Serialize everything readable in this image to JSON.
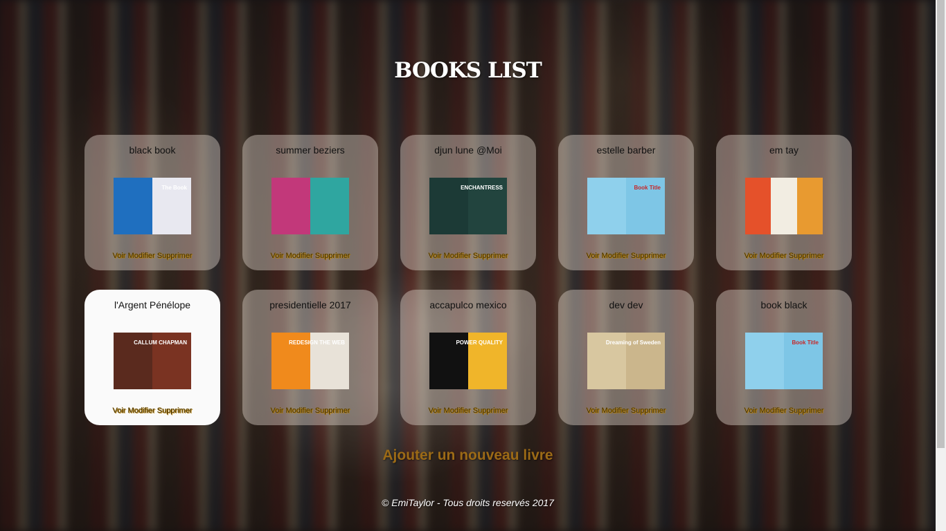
{
  "page": {
    "title": "BOOKS LIST"
  },
  "books": [
    {
      "title": "black book",
      "cover": {
        "colors": [
          "#1f6fbf",
          "#e8e8f0"
        ],
        "label": "The Book"
      }
    },
    {
      "title": "summer beziers",
      "cover": {
        "colors": [
          "#c2387a",
          "#2fa6a0"
        ],
        "label": ""
      }
    },
    {
      "title": "djun lune @Moi",
      "cover": {
        "colors": [
          "#1c3a36",
          "#22443e"
        ],
        "label": "ENCHANTRESS"
      }
    },
    {
      "title": "estelle barber",
      "cover": {
        "colors": [
          "#8fd0ec",
          "#7ec6e6"
        ],
        "label": "Book Title"
      }
    },
    {
      "title": "em tay",
      "cover": {
        "colors": [
          "#e5512a",
          "#f2ede2",
          "#e89a30"
        ],
        "label": ""
      }
    },
    {
      "title": "l'Argent Pénélope",
      "cover": {
        "colors": [
          "#5a2a1e",
          "#7a3322"
        ],
        "label": "CALLUM CHAPMAN"
      }
    },
    {
      "title": "presidentielle 2017",
      "cover": {
        "colors": [
          "#f08a1c",
          "#e8e2d8"
        ],
        "label": "REDESIGN THE WEB"
      }
    },
    {
      "title": "accapulco mexico",
      "cover": {
        "colors": [
          "#111111",
          "#f0b52a"
        ],
        "label": "POWER QUALITY"
      }
    },
    {
      "title": "dev dev",
      "cover": {
        "colors": [
          "#d8c7a0",
          "#cbb68c"
        ],
        "label": "Dreaming of Sweden"
      }
    },
    {
      "title": "book black",
      "cover": {
        "colors": [
          "#8fd0ec",
          "#7ec6e6"
        ],
        "label": "Book Title"
      }
    }
  ],
  "actions": {
    "view": "Voir",
    "edit": "Modifier",
    "delete": "Supprimer"
  },
  "add_link": "Ajouter un nouveau livre",
  "footer": "© EmiTaylor - Tous droits reservés 2017"
}
